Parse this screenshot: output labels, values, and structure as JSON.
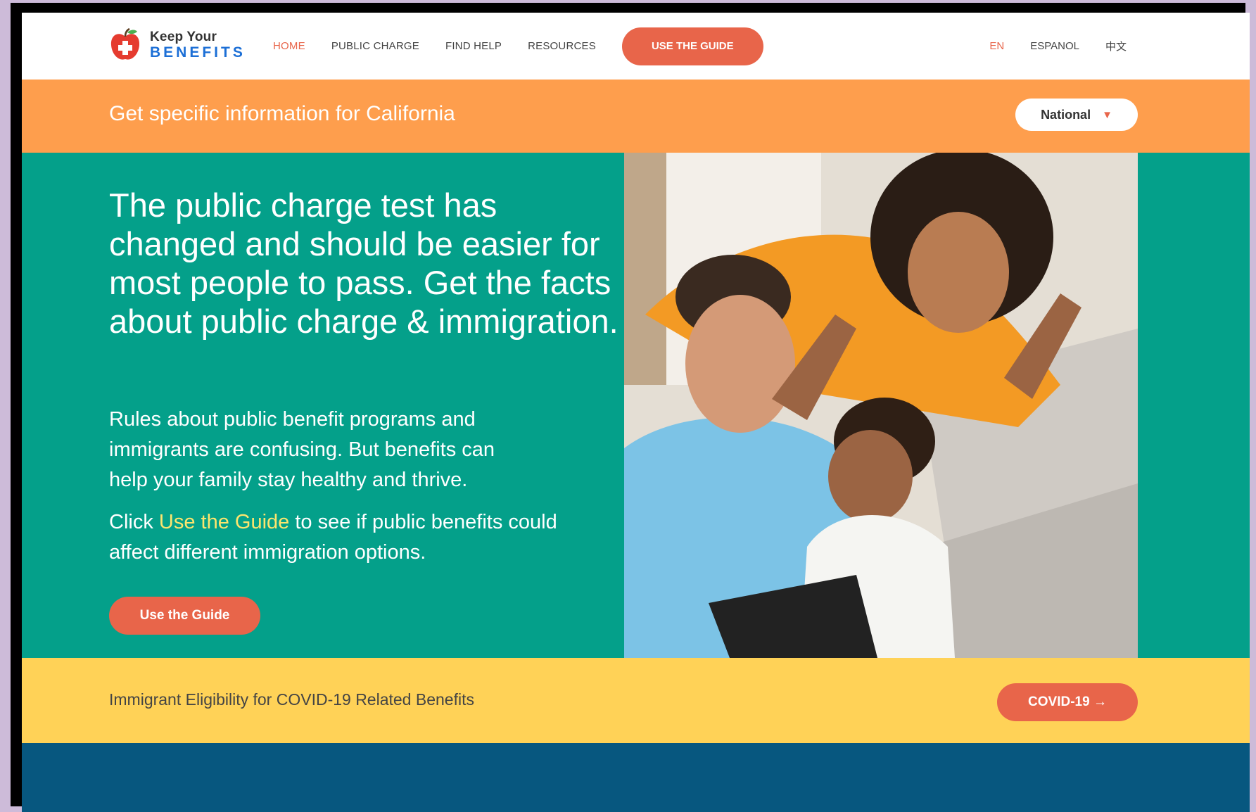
{
  "header": {
    "logo_line1": "Keep Your",
    "logo_line2": "BENEFITS",
    "nav": [
      {
        "label": "HOME",
        "active": true
      },
      {
        "label": "PUBLIC CHARGE"
      },
      {
        "label": "FIND HELP"
      },
      {
        "label": "RESOURCES"
      }
    ],
    "cta_label": "USE THE GUIDE",
    "languages": [
      {
        "label": "EN",
        "active": true
      },
      {
        "label": "ESPANOL"
      },
      {
        "label": "中文"
      }
    ]
  },
  "state_bar": {
    "text": "Get specific information for California",
    "select_value": "National"
  },
  "hero": {
    "title": "The public charge test has changed and should be easier for most people to pass. Get the facts about public charge & immigration.",
    "paragraph1": "Rules about public benefit programs and immigrants are confusing. But benefits can help your family stay healthy and thrive.",
    "p2_prefix": "Click ",
    "p2_link": "Use the Guide",
    "p2_suffix": " to see if public benefits could affect different immigration options.",
    "button_label": "Use the Guide"
  },
  "covid_bar": {
    "text": "Immigrant Eligibility for COVID-19 Related Benefits",
    "button_label": "COVID-19 →"
  },
  "colors": {
    "accent": "#e8654a",
    "orange_bar": "#fe9e4d",
    "teal": "#04a08a",
    "yellow": "#ffd257",
    "navy": "#07577f",
    "link_yellow": "#fde56e"
  }
}
